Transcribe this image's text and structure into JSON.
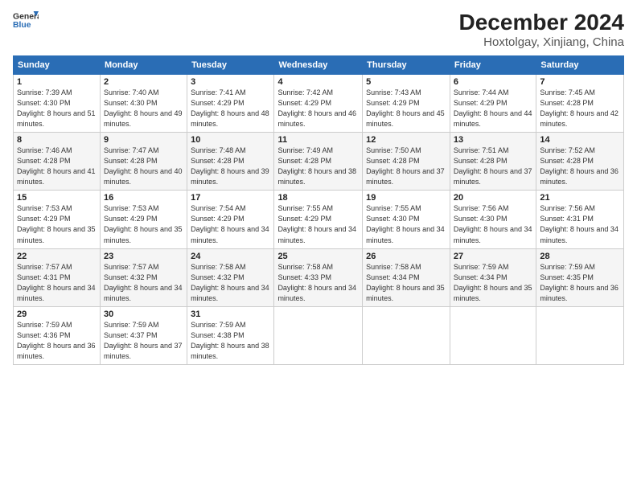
{
  "logo": {
    "line1": "General",
    "line2": "Blue"
  },
  "title": "December 2024",
  "subtitle": "Hoxtolgay, Xinjiang, China",
  "days_of_week": [
    "Sunday",
    "Monday",
    "Tuesday",
    "Wednesday",
    "Thursday",
    "Friday",
    "Saturday"
  ],
  "weeks": [
    [
      {
        "day": "1",
        "sunrise": "Sunrise: 7:39 AM",
        "sunset": "Sunset: 4:30 PM",
        "daylight": "Daylight: 8 hours and 51 minutes."
      },
      {
        "day": "2",
        "sunrise": "Sunrise: 7:40 AM",
        "sunset": "Sunset: 4:30 PM",
        "daylight": "Daylight: 8 hours and 49 minutes."
      },
      {
        "day": "3",
        "sunrise": "Sunrise: 7:41 AM",
        "sunset": "Sunset: 4:29 PM",
        "daylight": "Daylight: 8 hours and 48 minutes."
      },
      {
        "day": "4",
        "sunrise": "Sunrise: 7:42 AM",
        "sunset": "Sunset: 4:29 PM",
        "daylight": "Daylight: 8 hours and 46 minutes."
      },
      {
        "day": "5",
        "sunrise": "Sunrise: 7:43 AM",
        "sunset": "Sunset: 4:29 PM",
        "daylight": "Daylight: 8 hours and 45 minutes."
      },
      {
        "day": "6",
        "sunrise": "Sunrise: 7:44 AM",
        "sunset": "Sunset: 4:29 PM",
        "daylight": "Daylight: 8 hours and 44 minutes."
      },
      {
        "day": "7",
        "sunrise": "Sunrise: 7:45 AM",
        "sunset": "Sunset: 4:28 PM",
        "daylight": "Daylight: 8 hours and 42 minutes."
      }
    ],
    [
      {
        "day": "8",
        "sunrise": "Sunrise: 7:46 AM",
        "sunset": "Sunset: 4:28 PM",
        "daylight": "Daylight: 8 hours and 41 minutes."
      },
      {
        "day": "9",
        "sunrise": "Sunrise: 7:47 AM",
        "sunset": "Sunset: 4:28 PM",
        "daylight": "Daylight: 8 hours and 40 minutes."
      },
      {
        "day": "10",
        "sunrise": "Sunrise: 7:48 AM",
        "sunset": "Sunset: 4:28 PM",
        "daylight": "Daylight: 8 hours and 39 minutes."
      },
      {
        "day": "11",
        "sunrise": "Sunrise: 7:49 AM",
        "sunset": "Sunset: 4:28 PM",
        "daylight": "Daylight: 8 hours and 38 minutes."
      },
      {
        "day": "12",
        "sunrise": "Sunrise: 7:50 AM",
        "sunset": "Sunset: 4:28 PM",
        "daylight": "Daylight: 8 hours and 37 minutes."
      },
      {
        "day": "13",
        "sunrise": "Sunrise: 7:51 AM",
        "sunset": "Sunset: 4:28 PM",
        "daylight": "Daylight: 8 hours and 37 minutes."
      },
      {
        "day": "14",
        "sunrise": "Sunrise: 7:52 AM",
        "sunset": "Sunset: 4:28 PM",
        "daylight": "Daylight: 8 hours and 36 minutes."
      }
    ],
    [
      {
        "day": "15",
        "sunrise": "Sunrise: 7:53 AM",
        "sunset": "Sunset: 4:29 PM",
        "daylight": "Daylight: 8 hours and 35 minutes."
      },
      {
        "day": "16",
        "sunrise": "Sunrise: 7:53 AM",
        "sunset": "Sunset: 4:29 PM",
        "daylight": "Daylight: 8 hours and 35 minutes."
      },
      {
        "day": "17",
        "sunrise": "Sunrise: 7:54 AM",
        "sunset": "Sunset: 4:29 PM",
        "daylight": "Daylight: 8 hours and 34 minutes."
      },
      {
        "day": "18",
        "sunrise": "Sunrise: 7:55 AM",
        "sunset": "Sunset: 4:29 PM",
        "daylight": "Daylight: 8 hours and 34 minutes."
      },
      {
        "day": "19",
        "sunrise": "Sunrise: 7:55 AM",
        "sunset": "Sunset: 4:30 PM",
        "daylight": "Daylight: 8 hours and 34 minutes."
      },
      {
        "day": "20",
        "sunrise": "Sunrise: 7:56 AM",
        "sunset": "Sunset: 4:30 PM",
        "daylight": "Daylight: 8 hours and 34 minutes."
      },
      {
        "day": "21",
        "sunrise": "Sunrise: 7:56 AM",
        "sunset": "Sunset: 4:31 PM",
        "daylight": "Daylight: 8 hours and 34 minutes."
      }
    ],
    [
      {
        "day": "22",
        "sunrise": "Sunrise: 7:57 AM",
        "sunset": "Sunset: 4:31 PM",
        "daylight": "Daylight: 8 hours and 34 minutes."
      },
      {
        "day": "23",
        "sunrise": "Sunrise: 7:57 AM",
        "sunset": "Sunset: 4:32 PM",
        "daylight": "Daylight: 8 hours and 34 minutes."
      },
      {
        "day": "24",
        "sunrise": "Sunrise: 7:58 AM",
        "sunset": "Sunset: 4:32 PM",
        "daylight": "Daylight: 8 hours and 34 minutes."
      },
      {
        "day": "25",
        "sunrise": "Sunrise: 7:58 AM",
        "sunset": "Sunset: 4:33 PM",
        "daylight": "Daylight: 8 hours and 34 minutes."
      },
      {
        "day": "26",
        "sunrise": "Sunrise: 7:58 AM",
        "sunset": "Sunset: 4:34 PM",
        "daylight": "Daylight: 8 hours and 35 minutes."
      },
      {
        "day": "27",
        "sunrise": "Sunrise: 7:59 AM",
        "sunset": "Sunset: 4:34 PM",
        "daylight": "Daylight: 8 hours and 35 minutes."
      },
      {
        "day": "28",
        "sunrise": "Sunrise: 7:59 AM",
        "sunset": "Sunset: 4:35 PM",
        "daylight": "Daylight: 8 hours and 36 minutes."
      }
    ],
    [
      {
        "day": "29",
        "sunrise": "Sunrise: 7:59 AM",
        "sunset": "Sunset: 4:36 PM",
        "daylight": "Daylight: 8 hours and 36 minutes."
      },
      {
        "day": "30",
        "sunrise": "Sunrise: 7:59 AM",
        "sunset": "Sunset: 4:37 PM",
        "daylight": "Daylight: 8 hours and 37 minutes."
      },
      {
        "day": "31",
        "sunrise": "Sunrise: 7:59 AM",
        "sunset": "Sunset: 4:38 PM",
        "daylight": "Daylight: 8 hours and 38 minutes."
      },
      null,
      null,
      null,
      null
    ]
  ]
}
